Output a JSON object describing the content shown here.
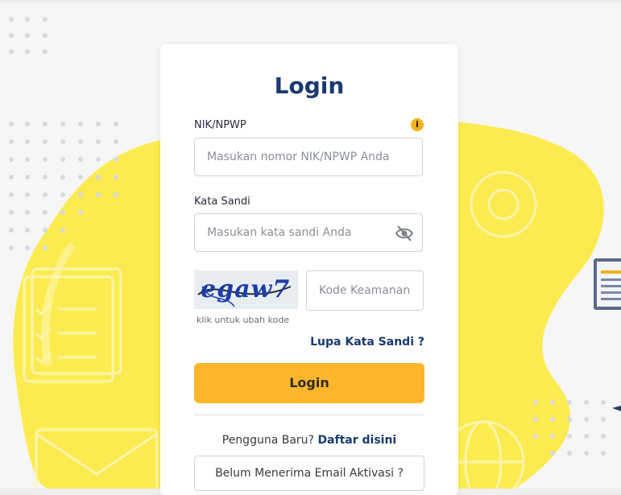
{
  "login": {
    "title": "Login",
    "nik_label": "NIK/NPWP",
    "nik_placeholder": "Masukan nomor NIK/NPWP Anda",
    "password_label": "Kata Sandi",
    "password_placeholder": "Masukan kata sandi Anda",
    "captcha_text": "egaw7",
    "captcha_hint": "klik untuk ubah kode",
    "code_placeholder": "Kode Keamanan",
    "forgot_link": "Lupa Kata Sandi ?",
    "login_button": "Login",
    "new_user_text": "Pengguna Baru?",
    "register_link": "Daftar disini",
    "activation_button": "Belum Menerima Email Aktivasi ?"
  },
  "icons": {
    "info": "info-icon",
    "password_toggle": "eye-slash-icon"
  },
  "colors": {
    "primary_text": "#1a3a6e",
    "button": "#fbb62b",
    "accent_yellow": "#fde933"
  }
}
